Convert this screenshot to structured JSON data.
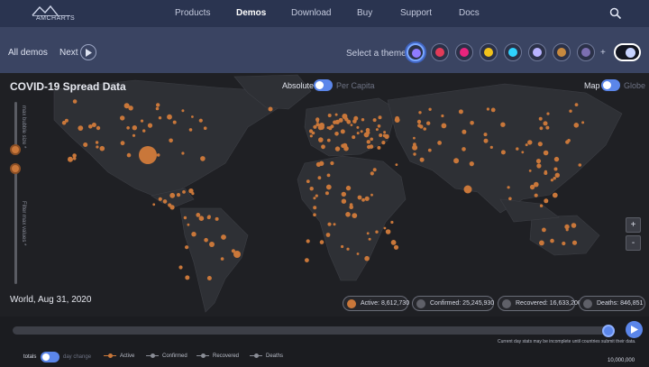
{
  "nav": {
    "logo_text": "AMCHARTS",
    "links": [
      "Products",
      "Demos",
      "Download",
      "Buy",
      "Support",
      "Docs"
    ],
    "active": "Demos"
  },
  "demobar": {
    "all_demos": "All demos",
    "next": "Next",
    "theme_label": "Select a theme:",
    "plus": "+",
    "themes": [
      {
        "name": "default",
        "color": "#8f7bff"
      },
      {
        "name": "dark",
        "color": "#e23b58"
      },
      {
        "name": "pink",
        "color": "#e8247d"
      },
      {
        "name": "yellow",
        "color": "#f1c21b"
      },
      {
        "name": "rainbow",
        "color": "#2fd3ff"
      },
      {
        "name": "lavender",
        "color": "#b8b2ff"
      },
      {
        "name": "brown",
        "color": "#c7893e"
      },
      {
        "name": "purple",
        "color": "#7c6fb1"
      }
    ]
  },
  "map": {
    "title": "COVID-19 Spread Data",
    "absolute": "Absolute",
    "per_capita": "Per Capita",
    "map": "Map",
    "globe": "Globe",
    "bubble_size_label": "max bubble size *",
    "filter_label": "Filter max values *",
    "zoom_in": "+",
    "zoom_out": "-",
    "date": "World, Aug 31, 2020",
    "accent": "#c9773a",
    "stats": [
      {
        "label": "Active: 8,612,730",
        "color": "#c9773a"
      },
      {
        "label": "Confirmed: 25,245,930",
        "color": "#5f6068"
      },
      {
        "label": "Recovered: 16,633,200",
        "color": "#5f6068"
      },
      {
        "label": "Deaths: 846,851",
        "color": "#5f6068"
      }
    ]
  },
  "bottom": {
    "note": "Current day stats may be incomplete until countries submit their data.",
    "totals": "totals",
    "day_change": "day change",
    "legend": [
      {
        "label": "Active",
        "color": "#c9773a"
      },
      {
        "label": "Confirmed",
        "color": "#8a8d96"
      },
      {
        "label": "Recovered",
        "color": "#8a8d96"
      },
      {
        "label": "Deaths",
        "color": "#8a8d96"
      }
    ],
    "scale": "10,000,000"
  }
}
